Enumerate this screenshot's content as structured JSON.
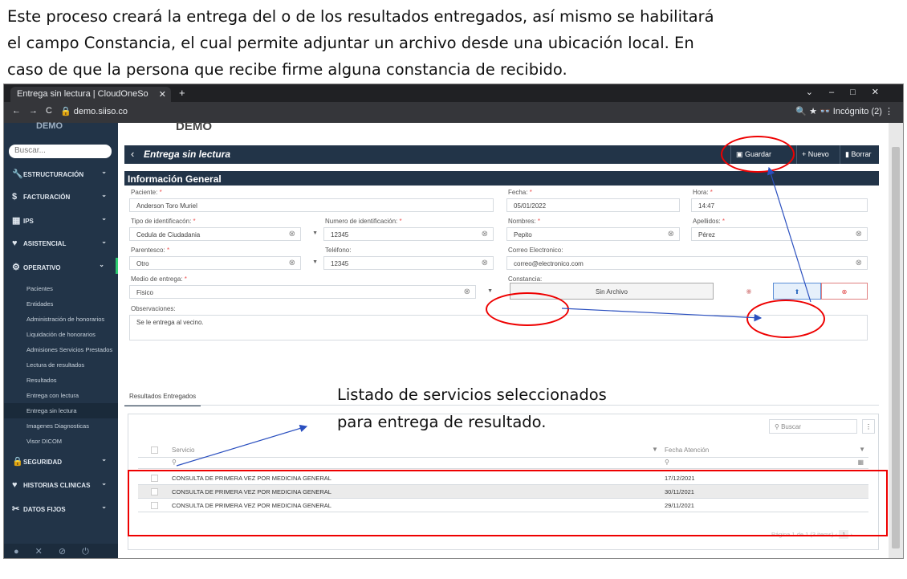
{
  "doc": {
    "line1": "Este proceso creará la entrega del o de los resultados entregados, así mismo se habilitará",
    "line2": "el campo Constancia, el cual permite adjuntar un archivo desde una ubicación local. En",
    "line3": "caso de que la persona que recibe firme alguna constancia de recibido."
  },
  "browser": {
    "tab_title": "Entrega sin lectura | CloudOneSo",
    "url": "demo.siiso.co",
    "incognito": "Incógnito (2)"
  },
  "app": {
    "brand": "DEMO"
  },
  "sidebar": {
    "search_placeholder": "Buscar...",
    "items": [
      {
        "label": "ESTRUCTURACIÓN",
        "icon": "wrench-icon"
      },
      {
        "label": "FACTURACIÓN",
        "icon": "dollar-icon"
      },
      {
        "label": "IPS",
        "icon": "hospital-icon"
      },
      {
        "label": "ASISTENCIAL",
        "icon": "heart-icon"
      },
      {
        "label": "OPERATIVO",
        "icon": "gears-icon"
      },
      {
        "label": "SEGURIDAD",
        "icon": "lock-icon"
      },
      {
        "label": "HISTORIAS CLINICAS",
        "icon": "heart-icon"
      },
      {
        "label": "DATOS FIJOS",
        "icon": "tools-icon"
      }
    ],
    "subitems": [
      "Pacientes",
      "Entidades",
      "Administración de honorarios",
      "Liquidación de honorarios",
      "Admisiones Servicios Prestados",
      "Lectura de resultados",
      "Resultados",
      "Entrega con lectura",
      "Entrega sin lectura",
      "Imagenes Diagnosticas",
      "Visor DICOM"
    ],
    "active_subitem": "Entrega sin lectura"
  },
  "header": {
    "title": "Entrega sin lectura",
    "save": "Guardar",
    "new": "Nuevo",
    "delete": "Borrar"
  },
  "section_title": "Información General",
  "form": {
    "paciente_label": "Paciente:",
    "paciente": "Anderson Toro Muriel",
    "fecha_label": "Fecha:",
    "fecha": "05/01/2022",
    "hora_label": "Hora:",
    "hora": "14:47",
    "tipo_id_label": "Tipo de identificacón:",
    "tipo_id": "Cedula de Ciudadania",
    "num_id_label": "Numero de identificación:",
    "num_id": "12345",
    "nombres_label": "Nombres:",
    "nombres": "Pepito",
    "apellidos_label": "Apellidos:",
    "apellidos": "Pérez",
    "parentesco_label": "Parentesco:",
    "parentesco": "Otro",
    "telefono_label": "Teléfono:",
    "telefono": "12345",
    "correo_label": "Correo Electronico:",
    "correo": "correo@electronico.com",
    "medio_label": "Medio de entrega:",
    "medio": "Fisico",
    "constancia_label": "Constancia:",
    "constancia": "Sin Archivo",
    "observaciones_label": "Observaciones:",
    "observaciones": "Se le entrega al vecino."
  },
  "tabs": {
    "resultados": "Resultados Entregados"
  },
  "grid": {
    "search_placeholder": "Buscar",
    "col_servicio": "Servicio",
    "col_fecha": "Fecha Atención",
    "rows": [
      {
        "servicio": "CONSULTA DE PRIMERA VEZ POR MEDICINA GENERAL",
        "fecha": "17/12/2021"
      },
      {
        "servicio": "CONSULTA DE PRIMERA VEZ POR MEDICINA GENERAL",
        "fecha": "30/11/2021"
      },
      {
        "servicio": "CONSULTA DE PRIMERA VEZ POR MEDICINA GENERAL",
        "fecha": "29/11/2021"
      }
    ],
    "pager": "Página 1 de 1 (3 items)",
    "page": "1"
  },
  "annotation": {
    "line1": "Listado de servicios seleccionados",
    "line2": "para entrega de resultado."
  },
  "colors": {
    "navy": "#223448",
    "annotation_red": "#e00000",
    "arrow_blue": "#2a4fbf"
  }
}
